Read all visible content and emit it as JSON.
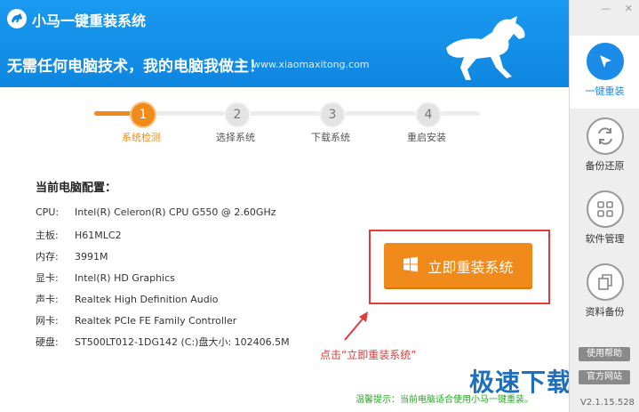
{
  "app": {
    "title": "小马一键重装系统",
    "slogan": "无需任何电脑技术，我的电脑我做主！",
    "website": "www.xiaomaxitong.com"
  },
  "window": {
    "minimize": "—",
    "close": "✕"
  },
  "steps": [
    {
      "num": "1",
      "label": "系统检测",
      "active": true
    },
    {
      "num": "2",
      "label": "选择系统",
      "active": false
    },
    {
      "num": "3",
      "label": "下载系统",
      "active": false
    },
    {
      "num": "4",
      "label": "重启安装",
      "active": false
    }
  ],
  "config": {
    "title": "当前电脑配置：",
    "rows": [
      {
        "label": "CPU:",
        "value": "Intel(R) Celeron(R) CPU G550 @ 2.60GHz"
      },
      {
        "label": "主板:",
        "value": "H61MLC2"
      },
      {
        "label": "内存:",
        "value": "3991M"
      },
      {
        "label": "显卡:",
        "value": "Intel(R) HD Graphics"
      },
      {
        "label": "声卡:",
        "value": "Realtek High Definition Audio"
      },
      {
        "label": "网卡:",
        "value": "Realtek PCIe FE Family Controller"
      },
      {
        "label": "硬盘:",
        "value": "ST500LT012-1DG142  (C:)盘大小: 102406.5M"
      }
    ]
  },
  "install_button": {
    "label": "立即重装系统",
    "icon": "windows-logo-icon"
  },
  "callout": "点击“立即重装系统”",
  "tip": "温馨提示：当前电脑适合使用小马一键重装。",
  "sidebar": {
    "items": [
      {
        "label": "一键重装",
        "icon": "cursor-icon",
        "active": true
      },
      {
        "label": "备份还原",
        "icon": "refresh-icon",
        "active": false
      },
      {
        "label": "软件管理",
        "icon": "grid-icon",
        "active": false
      },
      {
        "label": "资料备份",
        "icon": "copy-icon",
        "active": false
      }
    ],
    "help_label": "使用帮助",
    "help2_label": "官方网站",
    "version": "V2.1.15.528"
  },
  "watermark": "极速下载站",
  "colors": {
    "header_blue": "#0e86e0",
    "accent_orange": "#f08a1a",
    "alert_red": "#e23b3b",
    "tip_green": "#2aa52a"
  }
}
